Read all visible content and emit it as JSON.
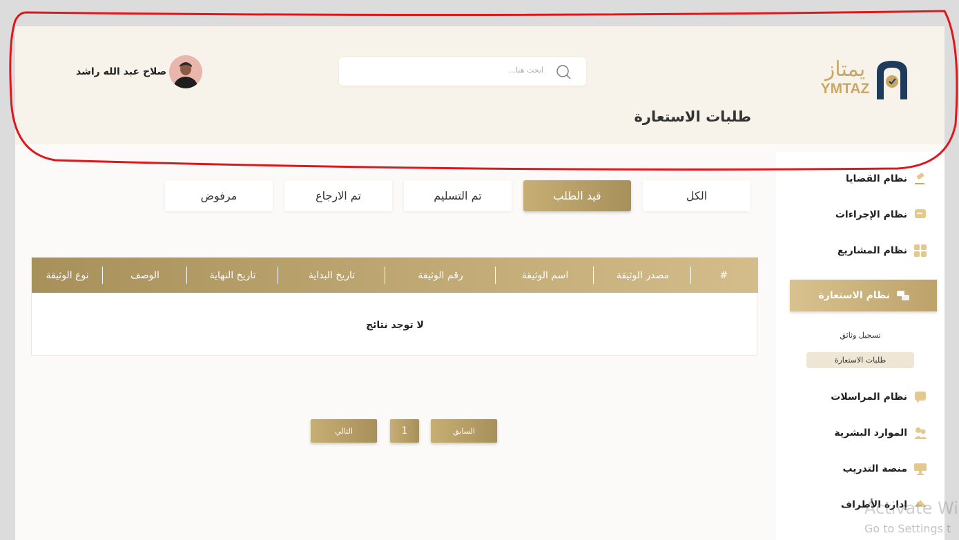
{
  "header": {
    "logo_text": "يمتاز",
    "logo_latin": "YMTAZ",
    "page_title": "طلبات الاستعارة",
    "search_placeholder": "ابحث هنا...",
    "user_name": "صلاح عبد الله راشد"
  },
  "sidebar": {
    "items": [
      {
        "label": "نظام القضايا",
        "icon": "gavel-icon"
      },
      {
        "label": "نظام الإجراءات",
        "icon": "procedures-icon"
      },
      {
        "label": "نظام المشاريع",
        "icon": "projects-icon"
      },
      {
        "label": "نظام الاستعارة",
        "icon": "borrowing-icon",
        "active": true
      },
      {
        "label": "نظام المراسلات",
        "icon": "messages-icon"
      },
      {
        "label": "الموارد البشرية",
        "icon": "people-icon"
      },
      {
        "label": "منصة التدريب",
        "icon": "training-icon"
      },
      {
        "label": "إدارة الأطراف",
        "icon": "parties-icon"
      }
    ],
    "sub_items": [
      "تسجيل وثائق",
      "طلبات الاستعارة"
    ]
  },
  "tabs": [
    "الكل",
    "قيد الطلب",
    "تم التسليم",
    "تم الارجاع",
    "مرفوض"
  ],
  "table": {
    "headers": [
      "#",
      "مصدر الوثيقة",
      "اسم الوثيقة",
      "رقم الوثيقة",
      "تاريخ البداية",
      "تاريخ النهاية",
      "الوصف",
      "نوع الوثيقة"
    ],
    "empty_text": "لا توجد نتائج"
  },
  "pagination": {
    "prev": "السابق",
    "page": "1",
    "next": "التالي"
  },
  "watermark": {
    "line1": "Activate Wi",
    "line2": "Go to Settings t"
  },
  "colors": {
    "gold": "#bda26a",
    "header_bg": "#f7f2ea",
    "annotation": "#e0161b"
  }
}
